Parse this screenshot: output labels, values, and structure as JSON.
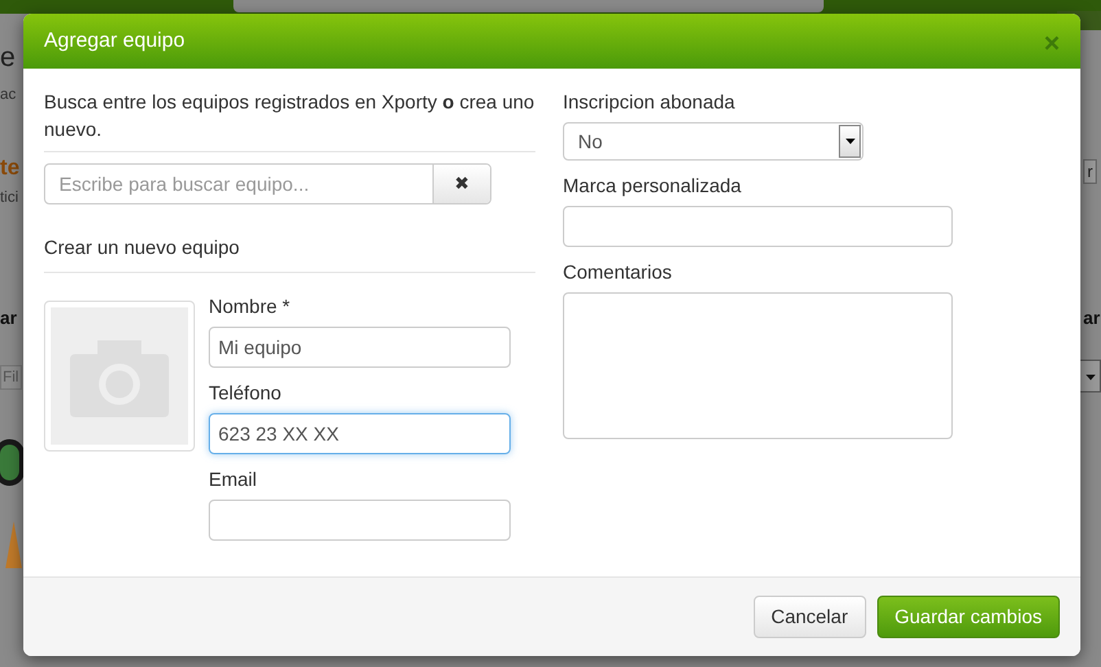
{
  "background_page": {
    "left_fragments": [
      {
        "text": "e",
        "kind": "heading"
      },
      {
        "text": "ac",
        "kind": "small"
      },
      {
        "text": "te",
        "kind": "accent"
      },
      {
        "text": "tici",
        "kind": "small"
      },
      {
        "text": "ar",
        "kind": "bold"
      },
      {
        "text": "Fil",
        "kind": "field"
      }
    ],
    "right_fragments": [
      {
        "text": "r",
        "kind": "button"
      },
      {
        "text": "ar",
        "kind": "bold"
      }
    ]
  },
  "dialog": {
    "title": "Agregar equipo",
    "close": "×",
    "intro": "Busca entre los equipos registrados en Xporty **o** crea uno nuevo.",
    "search": {
      "placeholder": "Escribe para buscar equipo...",
      "clear": "✖"
    },
    "create_heading": "Crear un nuevo equipo",
    "fields": [
      {
        "label": "Nombre *",
        "value": "Mi equipo",
        "focused": false
      },
      {
        "label": "Teléfono",
        "value": "623 23 XX XX",
        "focused": true
      },
      {
        "label": "Email",
        "focused": false
      }
    ],
    "right_fields": [
      {
        "kind": "select",
        "label": "Inscripcion abonada",
        "value": "No"
      },
      {
        "kind": "text",
        "label": "Marca personalizada"
      },
      {
        "kind": "textarea",
        "label": "Comentarios"
      }
    ],
    "buttons": [
      {
        "label": "Cancelar",
        "kind": "default"
      },
      {
        "label": "Guardar cambios",
        "kind": "primary"
      }
    ]
  }
}
